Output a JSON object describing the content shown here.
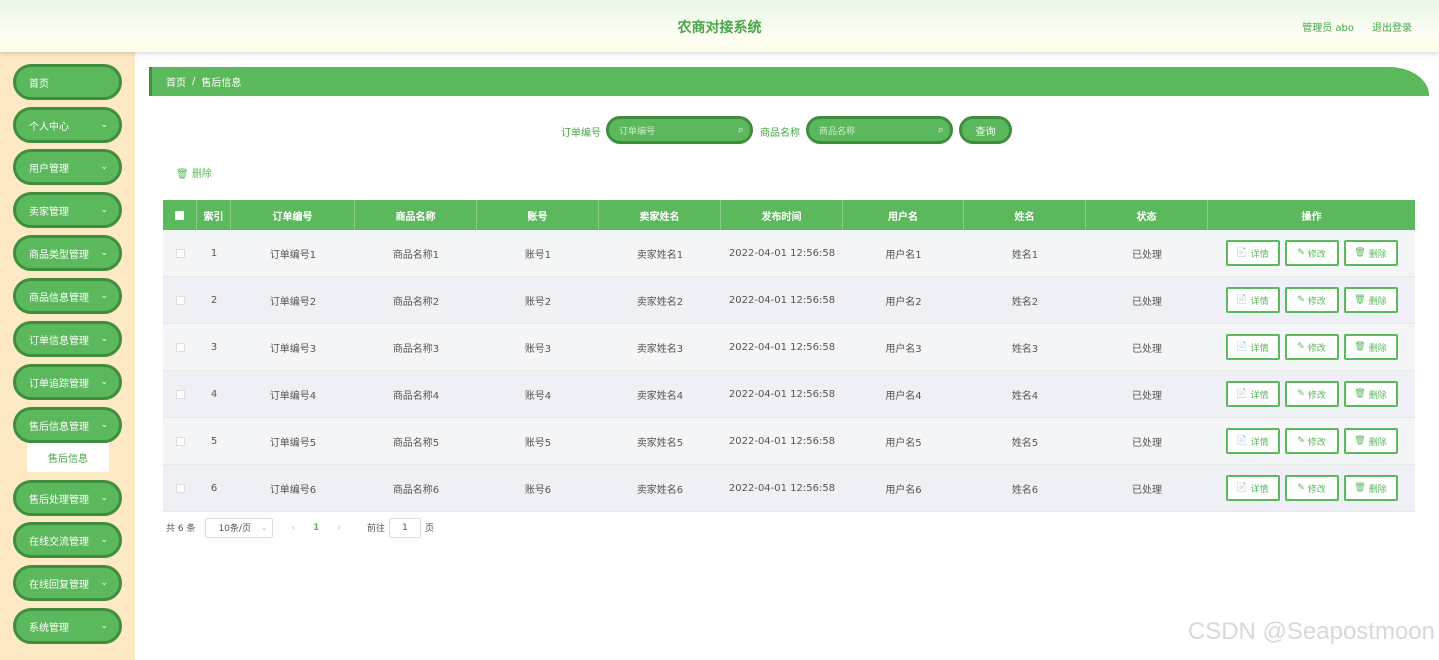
{
  "header": {
    "title": "农商对接系统",
    "user": "管理员 abo",
    "logout": "退出登录"
  },
  "sidebar": {
    "items": [
      {
        "label": "首页"
      },
      {
        "label": "个人中心"
      },
      {
        "label": "用户管理"
      },
      {
        "label": "卖家管理"
      },
      {
        "label": "商品类型管理"
      },
      {
        "label": "商品信息管理"
      },
      {
        "label": "订单信息管理"
      },
      {
        "label": "订单追踪管理"
      },
      {
        "label": "售后信息管理"
      },
      {
        "label": "售后处理管理"
      },
      {
        "label": "在线交流管理"
      },
      {
        "label": "在线回复管理"
      },
      {
        "label": "系统管理"
      }
    ],
    "active_sub": "售后信息"
  },
  "breadcrumb": {
    "home": "首页",
    "sep": "/",
    "current": "售后信息"
  },
  "search": {
    "order_label": "订单编号",
    "order_placeholder": "订单编号",
    "product_label": "商品名称",
    "product_placeholder": "商品名称",
    "query_btn": "查询"
  },
  "toolbar": {
    "delete_label": "删除"
  },
  "table": {
    "headers": [
      "索引",
      "订单编号",
      "商品名称",
      "账号",
      "卖家姓名",
      "发布时间",
      "用户名",
      "姓名",
      "状态",
      "操作"
    ],
    "rows": [
      [
        "1",
        "订单编号1",
        "商品名称1",
        "账号1",
        "卖家姓名1",
        "2022-04-01 12:56:58",
        "用户名1",
        "姓名1",
        "已处理"
      ],
      [
        "2",
        "订单编号2",
        "商品名称2",
        "账号2",
        "卖家姓名2",
        "2022-04-01 12:56:58",
        "用户名2",
        "姓名2",
        "已处理"
      ],
      [
        "3",
        "订单编号3",
        "商品名称3",
        "账号3",
        "卖家姓名3",
        "2022-04-01 12:56:58",
        "用户名3",
        "姓名3",
        "已处理"
      ],
      [
        "4",
        "订单编号4",
        "商品名称4",
        "账号4",
        "卖家姓名4",
        "2022-04-01 12:56:58",
        "用户名4",
        "姓名4",
        "已处理"
      ],
      [
        "5",
        "订单编号5",
        "商品名称5",
        "账号5",
        "卖家姓名5",
        "2022-04-01 12:56:58",
        "用户名5",
        "姓名5",
        "已处理"
      ],
      [
        "6",
        "订单编号6",
        "商品名称6",
        "账号6",
        "卖家姓名6",
        "2022-04-01 12:56:58",
        "用户名6",
        "姓名6",
        "已处理"
      ]
    ],
    "actions": {
      "detail": "详情",
      "edit": "修改",
      "delete": "删除"
    }
  },
  "pagination": {
    "total": "共 6 条",
    "page_size": "10条/页",
    "prev": "‹",
    "current_page": "1",
    "next": "›",
    "goto_label": "前往",
    "goto_value": "1",
    "page_suffix": "页"
  },
  "watermark": "CSDN @Seapostmoon",
  "colors": {
    "primary": "#5cb85c",
    "primary_dark": "#3e8e3e",
    "sidebar_bg": "#fde9c3"
  }
}
